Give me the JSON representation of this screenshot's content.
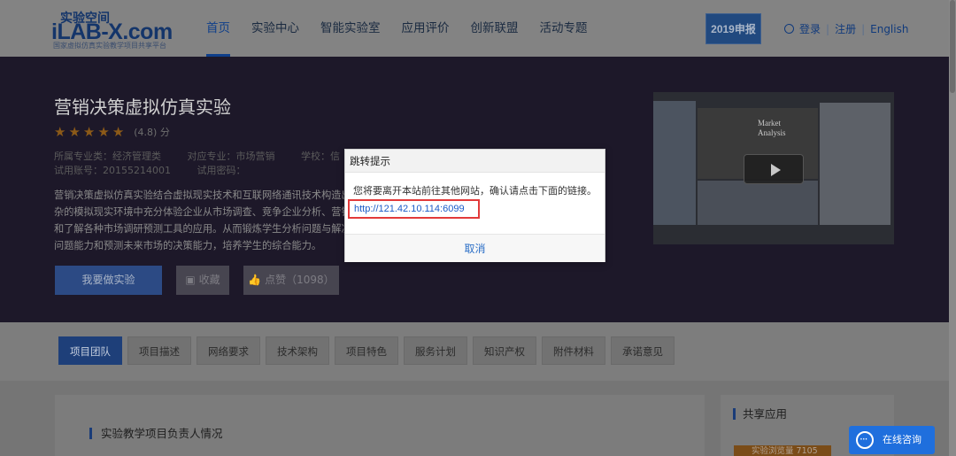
{
  "header": {
    "logo_top": "实验空间",
    "logo_main": "iLAB-X.com",
    "logo_sub": "国家虚拟仿真实验教学项目共享平台",
    "nav": [
      {
        "label": "首页",
        "active": true
      },
      {
        "label": "实验中心",
        "active": false
      },
      {
        "label": "智能实验室",
        "active": false
      },
      {
        "label": "应用评价",
        "active": false
      },
      {
        "label": "创新联盟",
        "active": false
      },
      {
        "label": "活动专题",
        "active": false
      }
    ],
    "year_badge": "2019申报",
    "login": "登录",
    "register": "注册",
    "language": "English",
    "separator": "|"
  },
  "project": {
    "title": "营销决策虚拟仿真实验",
    "stars": 5,
    "rating": "(4.8) 分",
    "meta_row1": [
      "所属专业类：经济管理类",
      "对应专业：市场营销",
      "学校：信"
    ],
    "meta_row2": [
      "试用账号：20155214001",
      "试用密码："
    ],
    "description": [
      "营销决策虚拟仿真实验结合虚拟现实技术和互联网络通讯技术构造出",
      "杂的模拟现实环境中充分体验企业从市场调查、竞争企业分析、营销",
      "和了解各种市场调研预测工具的应用。从而锻炼学生分析问题与解决",
      "问题能力和预测未来市场的决策能力，培养学生的综合能力。"
    ],
    "btn_do": "我要做实验",
    "btn_fav": "收藏",
    "btn_like": "点赞（1098）",
    "video_text": [
      "Market",
      "Analysis"
    ]
  },
  "tabs": [
    {
      "label": "项目团队",
      "active": true
    },
    {
      "label": "项目描述",
      "active": false
    },
    {
      "label": "网络要求",
      "active": false
    },
    {
      "label": "技术架构",
      "active": false
    },
    {
      "label": "项目特色",
      "active": false
    },
    {
      "label": "服务计划",
      "active": false
    },
    {
      "label": "知识产权",
      "active": false
    },
    {
      "label": "附件材料",
      "active": false
    },
    {
      "label": "承诺意见",
      "active": false
    }
  ],
  "content": {
    "section_title": "实验教学项目负责人情况",
    "share_title": "共享应用",
    "visits": "实验浏览量 7105"
  },
  "chat": {
    "label": "在线咨询"
  },
  "modal": {
    "title": "跳转提示",
    "message": "您将要离开本站前往其他网站，确认请点击下面的链接。",
    "link": "http://121.42.10.114:6099",
    "cancel": "取消"
  }
}
